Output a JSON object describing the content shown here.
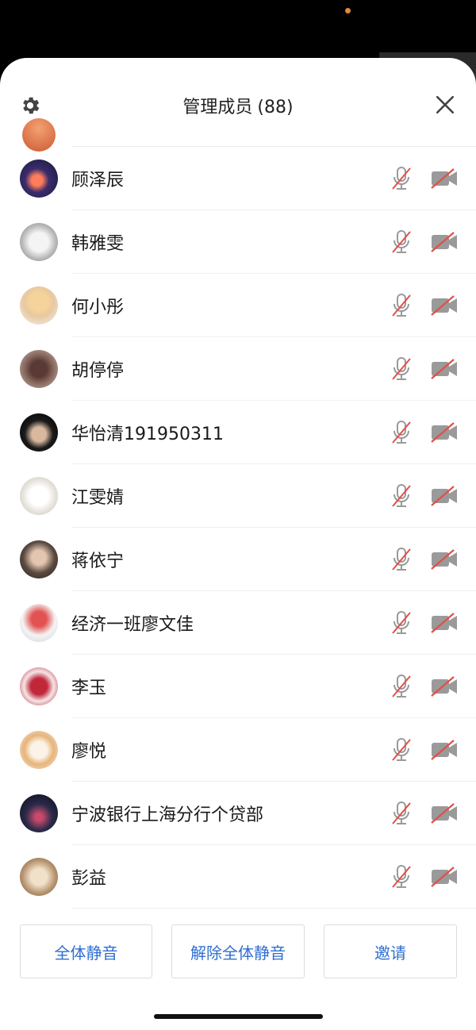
{
  "header": {
    "title": "管理成员",
    "count": "(88)"
  },
  "members": [
    {
      "name": "顾泽辰",
      "avatar": "avatar-sky"
    },
    {
      "name": "韩雅雯",
      "avatar": "avatar-tiger"
    },
    {
      "name": "何小彤",
      "avatar": "avatar-cartoon"
    },
    {
      "name": "胡停停",
      "avatar": "avatar-flowers"
    },
    {
      "name": "华怡清191950311",
      "avatar": "avatar-hands"
    },
    {
      "name": "江雯婧",
      "avatar": "avatar-cat"
    },
    {
      "name": "蒋依宁",
      "avatar": "avatar-girl"
    },
    {
      "name": "经济一班廖文佳",
      "avatar": "avatar-anime"
    },
    {
      "name": "李玉",
      "avatar": "avatar-emblem"
    },
    {
      "name": "廖悦",
      "avatar": "avatar-dog"
    },
    {
      "name": "宁波银行上海分行个贷部",
      "avatar": "avatar-city"
    },
    {
      "name": "彭益",
      "avatar": "avatar-puppy"
    }
  ],
  "footer": {
    "mute_all": "全体静音",
    "unmute_all": "解除全体静音",
    "invite": "邀请"
  },
  "colors": {
    "accent": "#2f6fd1",
    "muted_slash": "#e0504a",
    "icon_gray": "#9a9a9a"
  }
}
